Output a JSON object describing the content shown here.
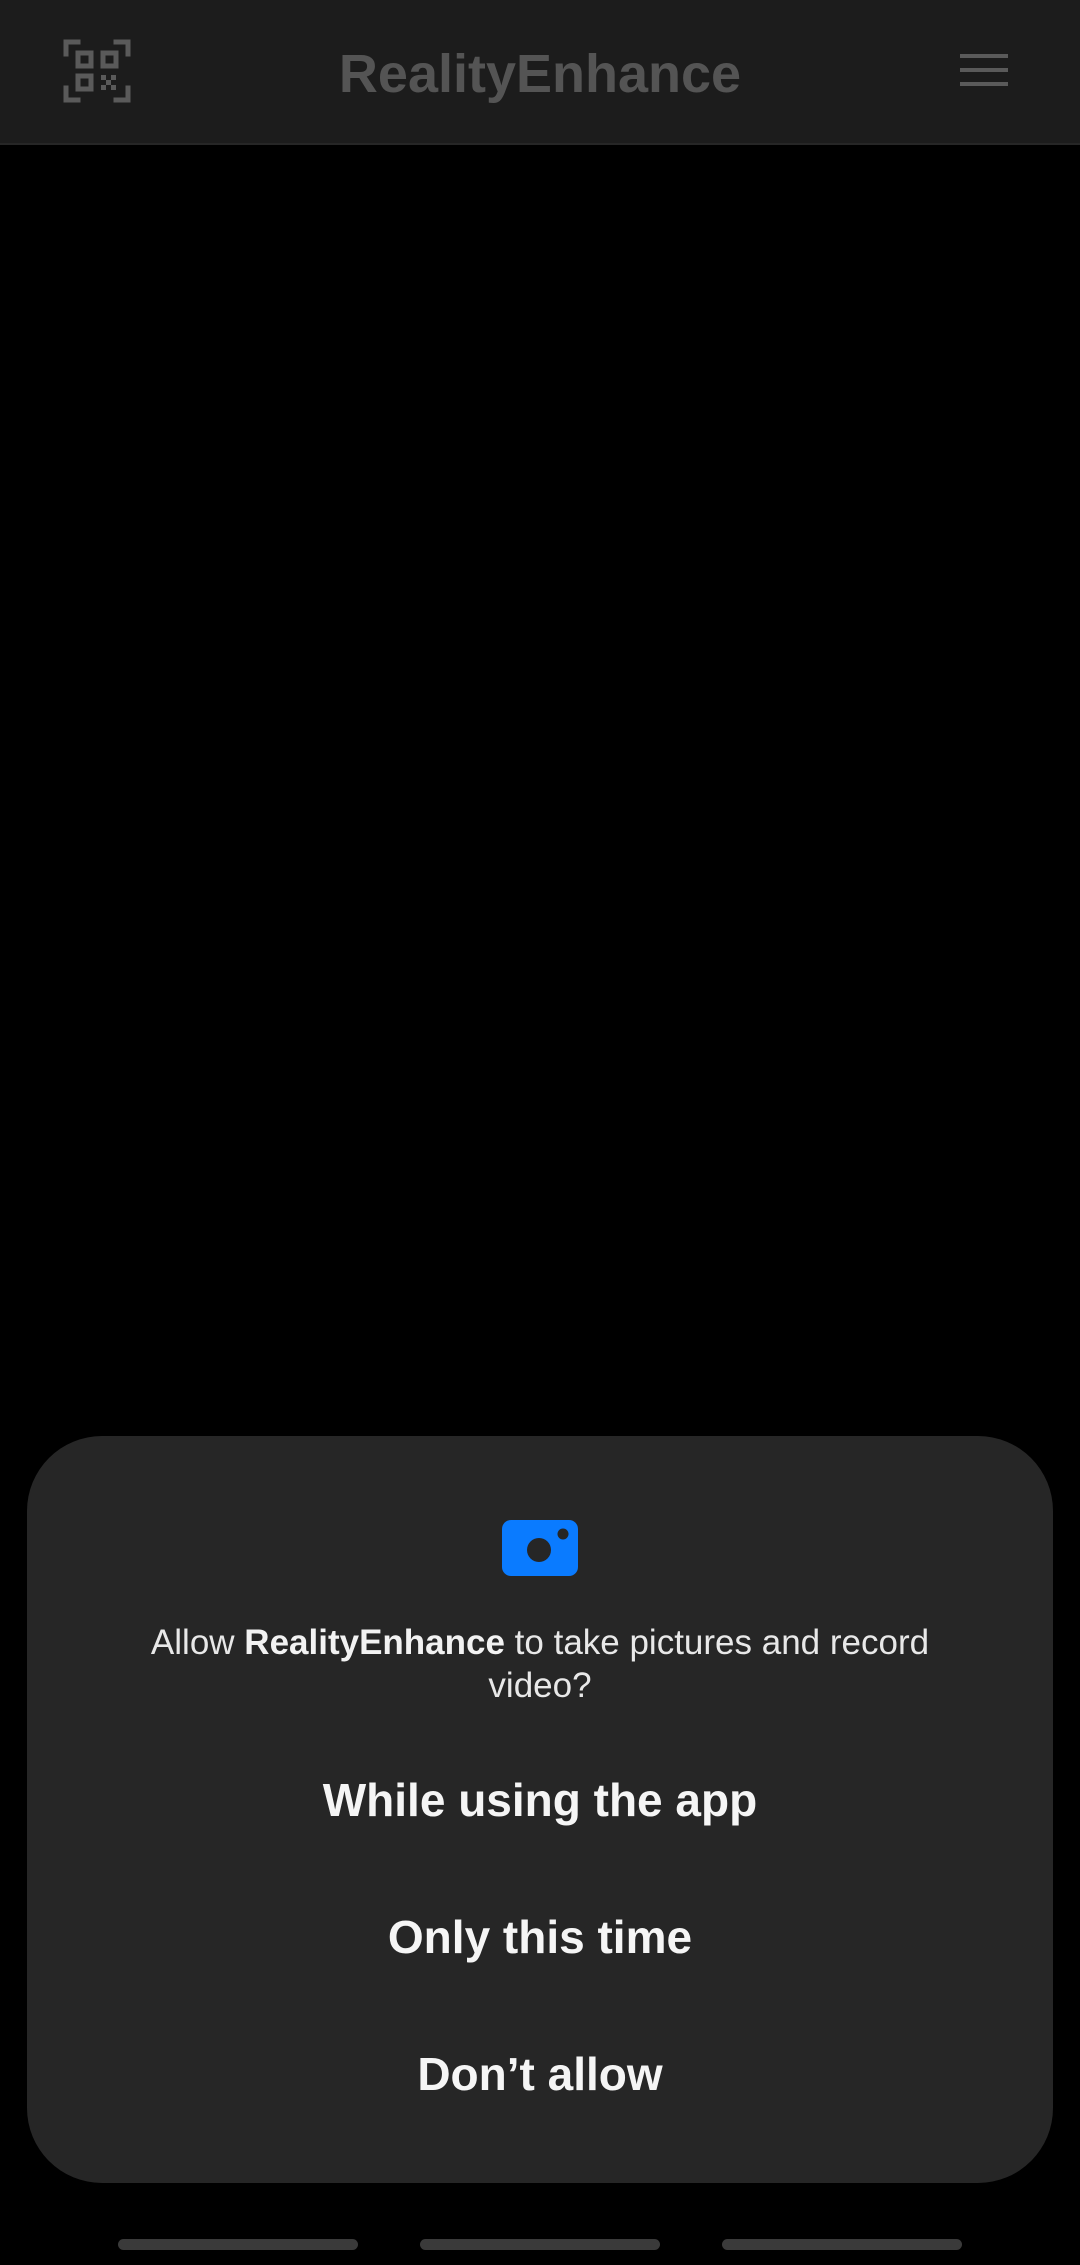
{
  "app_bar": {
    "title": "RealityEnhance",
    "qr_icon": "qr-code-scan-icon",
    "menu_icon": "hamburger-menu-icon",
    "title_color": "#545454",
    "background": "#1c1c1c"
  },
  "permission_dialog": {
    "icon": "camera-icon",
    "icon_color": "#0a7bff",
    "message_prefix": "Allow ",
    "app_name": "RealityEnhance",
    "message_suffix": " to take pictures and record video?",
    "options": [
      {
        "label": "While using the app"
      },
      {
        "label": "Only this time"
      },
      {
        "label": "Don’t allow"
      }
    ],
    "background": "#262626"
  },
  "navigation_bar": {
    "pills": [
      "recent-apps-pill",
      "home-pill",
      "back-pill"
    ]
  }
}
